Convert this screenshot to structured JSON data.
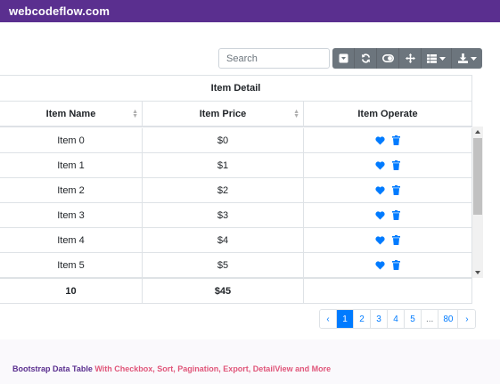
{
  "header": {
    "brand": "webcodeflow.com"
  },
  "search": {
    "placeholder": "Search"
  },
  "toolbar": {
    "icons": [
      "toggle-pagination-icon",
      "refresh-icon",
      "toggle-view-icon",
      "fullscreen-icon",
      "columns-icon",
      "export-icon"
    ]
  },
  "table": {
    "group_header": "Item Detail",
    "columns": [
      "Item Name",
      "Item Price",
      "Item Operate"
    ],
    "rows": [
      {
        "name": "Item 0",
        "price": "$0"
      },
      {
        "name": "Item 1",
        "price": "$1"
      },
      {
        "name": "Item 2",
        "price": "$2"
      },
      {
        "name": "Item 3",
        "price": "$3"
      },
      {
        "name": "Item 4",
        "price": "$4"
      },
      {
        "name": "Item 5",
        "price": "$5"
      }
    ],
    "footer": {
      "count": "10",
      "total": "$45",
      "operate": ""
    }
  },
  "pagination": {
    "prev": "‹",
    "pages": [
      "1",
      "2",
      "3",
      "4",
      "5",
      "...",
      "80"
    ],
    "active": "1",
    "next": "›"
  },
  "footer": {
    "title_part1": "Bootstrap Data Table",
    "title_part2": "With Checkbox, Sort, Pagination, Export, DetailView and More"
  },
  "colors": {
    "brand": "#5a2f8f",
    "accent": "#007bff",
    "secondary": "#6c757d",
    "pink": "#e0567a"
  }
}
